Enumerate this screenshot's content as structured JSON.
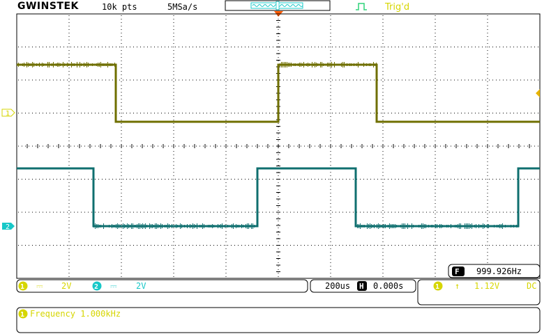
{
  "header": {
    "brand": "GWINSTEK",
    "record_length": "10k pts",
    "sample_rate": "5MSa/s",
    "trigger_status": "Trig'd"
  },
  "measurement": {
    "badge": "F",
    "value": "999.926Hz"
  },
  "channels": [
    {
      "num": "1",
      "coupling": "⎓",
      "scale": "2V",
      "color": "#d6d600",
      "trace_color": "#6f6f00"
    },
    {
      "num": "2",
      "coupling": "⎓",
      "scale": "2V",
      "color": "#17c8c8",
      "trace_color": "#0f6f6f"
    }
  ],
  "timebase": {
    "scale": "200us",
    "h_badge": "H",
    "position": "0.000s"
  },
  "trigger": {
    "source": "1",
    "slope": "↑",
    "level": "1.12V",
    "coupling": "DC"
  },
  "message": {
    "badge": "1",
    "text": "Frequency 1.000kHz"
  },
  "colors": {
    "grid": "#000000",
    "ch1": "#d6d600",
    "ch2": "#17c8c8",
    "trigger_marker": "#ff5a00"
  }
}
